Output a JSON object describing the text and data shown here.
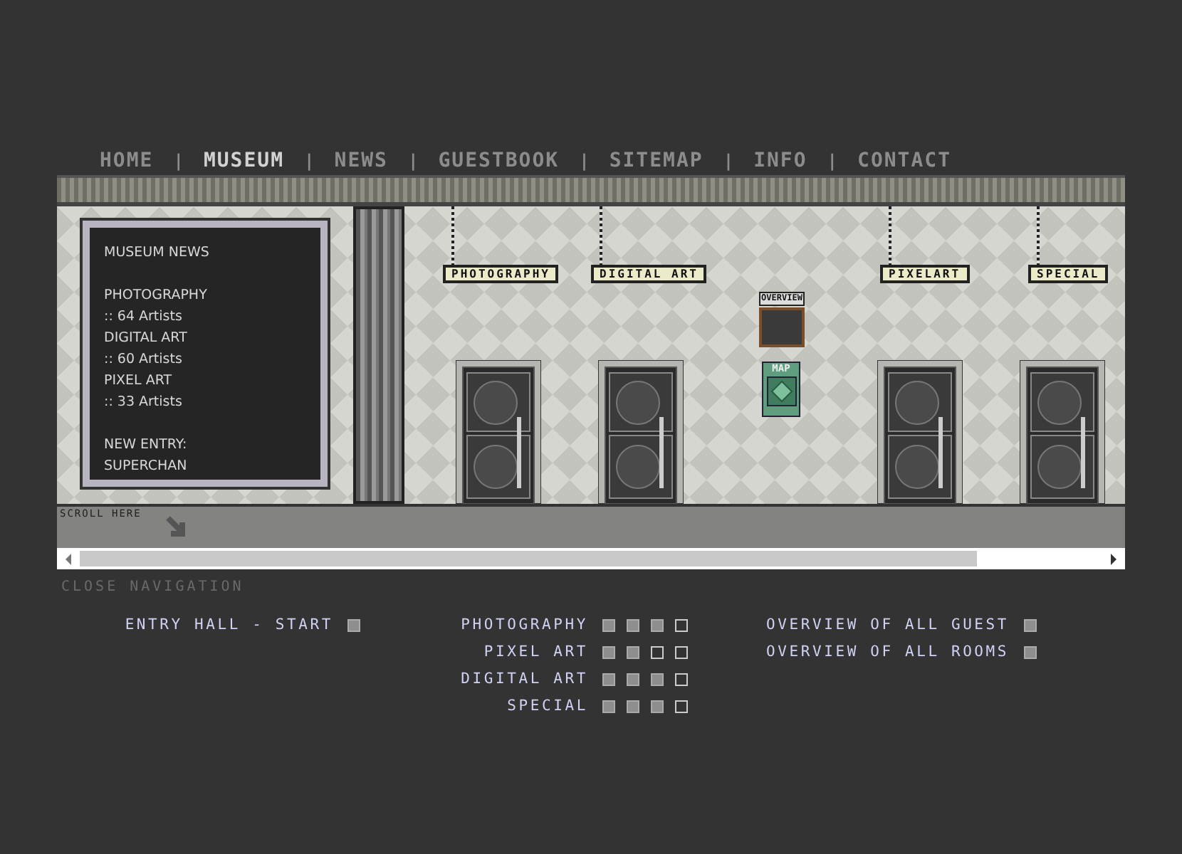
{
  "nav": [
    {
      "kind": "link",
      "label": "HOME",
      "selected": false
    },
    {
      "kind": "separator",
      "label": "|"
    },
    {
      "kind": "link",
      "label": "MUSEUM",
      "selected": true
    },
    {
      "kind": "separator",
      "label": "|"
    },
    {
      "kind": "link",
      "label": "NEWS",
      "selected": false
    },
    {
      "kind": "separator",
      "label": "|"
    },
    {
      "kind": "link",
      "label": "GUESTBOOK",
      "selected": false
    },
    {
      "kind": "separator",
      "label": "|"
    },
    {
      "kind": "link",
      "label": "SITEMAP",
      "selected": false
    },
    {
      "kind": "separator",
      "label": "|"
    },
    {
      "kind": "link",
      "label": "INFO",
      "selected": false
    },
    {
      "kind": "separator",
      "label": "|"
    },
    {
      "kind": "link",
      "label": "CONTACT",
      "selected": false
    }
  ],
  "news": {
    "title": "MUSEUM NEWS",
    "groups": [
      [
        "PHOTOGRAPHY",
        ":: 64 Artists",
        "DIGITAL ART",
        ":: 60 Artists",
        "PIXEL ART",
        ":: 33 Artists"
      ],
      [
        "NEW ENTRY:",
        "SUPERCHAN"
      ]
    ]
  },
  "rooms": [
    {
      "sign": "PHOTOGRAPHY"
    },
    {
      "sign": "DIGITAL ART"
    },
    {
      "sign": "PIXELART"
    },
    {
      "sign": "SPECIAL"
    }
  ],
  "overview": {
    "label": "OVERVIEW"
  },
  "map": {
    "label": "MAP"
  },
  "scroll_hint": "SCROLL HERE",
  "close_navigation": "CLOSE NAVIGATION",
  "sitemap": [
    [
      {
        "label": "ENTRY HALL - START",
        "rooms": [
          {
            "filled": true
          }
        ]
      }
    ],
    [
      {
        "label": "PHOTOGRAPHY",
        "rooms": [
          {
            "filled": true
          },
          {
            "filled": true
          },
          {
            "filled": true
          },
          {
            "filled": false
          }
        ]
      },
      {
        "label": "PIXEL ART",
        "rooms": [
          {
            "filled": true
          },
          {
            "filled": true
          },
          {
            "filled": false
          },
          {
            "filled": false
          }
        ]
      },
      {
        "label": "DIGITAL ART",
        "rooms": [
          {
            "filled": true
          },
          {
            "filled": true
          },
          {
            "filled": true
          },
          {
            "filled": false
          }
        ]
      },
      {
        "label": "SPECIAL",
        "rooms": [
          {
            "filled": true
          },
          {
            "filled": true
          },
          {
            "filled": true
          },
          {
            "filled": false
          }
        ]
      }
    ],
    [
      {
        "label": "OVERVIEW OF ALL GUEST",
        "rooms": [
          {
            "filled": true
          }
        ]
      },
      {
        "label": "OVERVIEW OF ALL ROOMS",
        "rooms": [
          {
            "filled": true
          }
        ]
      }
    ]
  ]
}
